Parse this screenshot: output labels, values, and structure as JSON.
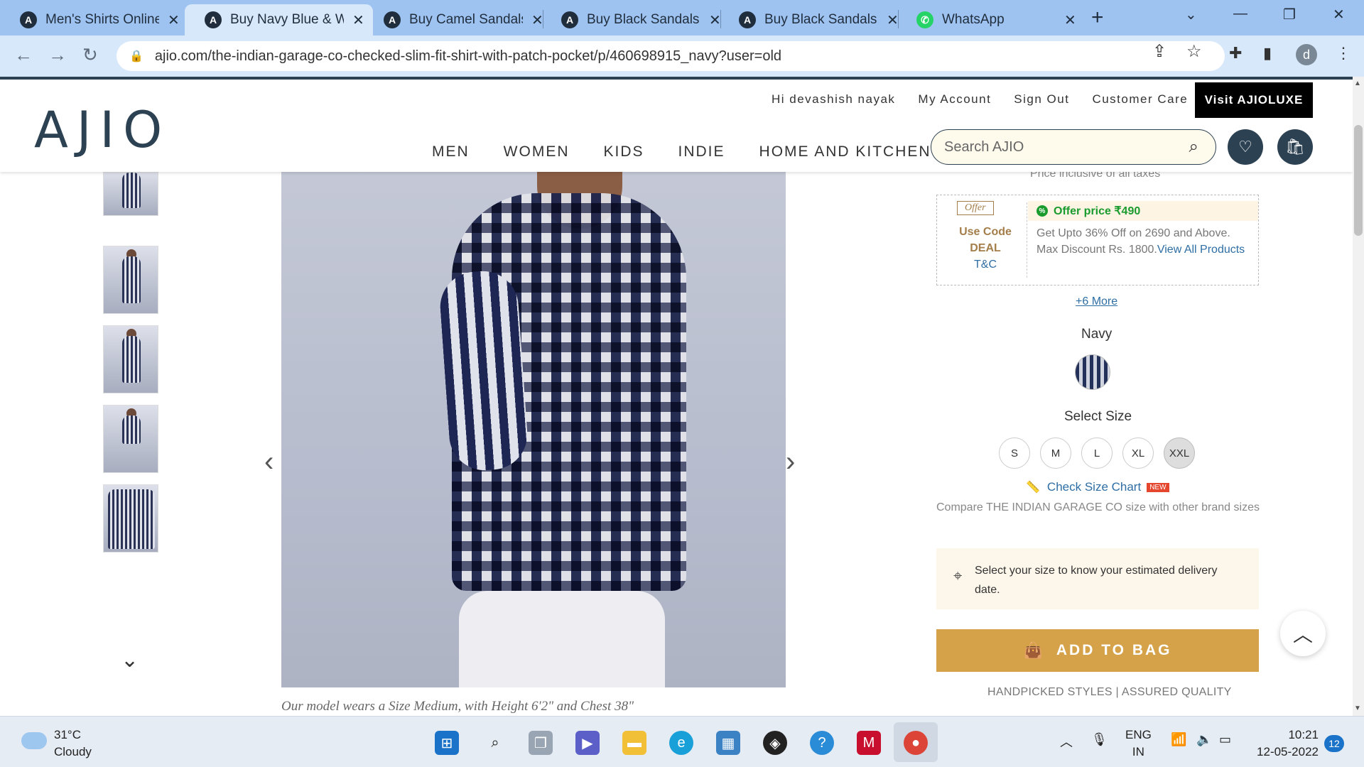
{
  "browser": {
    "tabs": [
      {
        "title": "Men's Shirts Online",
        "icon": "ajio-icon"
      },
      {
        "title": "Buy Navy Blue & White",
        "icon": "ajio-icon",
        "active": true
      },
      {
        "title": "Buy Camel Sandals",
        "icon": "ajio-icon"
      },
      {
        "title": "Buy Black Sandals f",
        "icon": "ajio-icon"
      },
      {
        "title": "Buy Black Sandals f",
        "icon": "ajio-icon"
      },
      {
        "title": "WhatsApp",
        "icon": "whatsapp-icon"
      }
    ],
    "url": "ajio.com/the-indian-garage-co-checked-slim-fit-shirt-with-patch-pocket/p/460698915_navy?user=old",
    "profile_initial": "d"
  },
  "header": {
    "logo": "AJIO",
    "greeting": "Hi devashish nayak",
    "links": [
      "My Account",
      "Sign Out",
      "Customer Care"
    ],
    "luxe": "Visit AJIOLUXE",
    "nav": [
      "MEN",
      "WOMEN",
      "KIDS",
      "INDIE",
      "HOME AND KITCHEN"
    ],
    "search_placeholder": "Search AJIO"
  },
  "product": {
    "caption": "Our model wears a Size Medium, with Height 6'2\" and Chest 38\"",
    "price_note": "Price inclusive of all taxes",
    "offer": {
      "tag": "Offer",
      "use_code": "Use Code",
      "code": "DEAL",
      "tc": "T&C",
      "offer_price": "Offer price ₹490",
      "desc": "Get Upto 36% Off on 2690 and Above. Max Discount Rs. 1800.",
      "link": "View All Products"
    },
    "more": "+6 More",
    "color": "Navy",
    "select_size": "Select Size",
    "sizes": [
      "S",
      "M",
      "L",
      "XL",
      "XXL"
    ],
    "selected_size": "XXL",
    "size_chart": "Check Size Chart",
    "new_badge": "NEW",
    "compare": "Compare THE INDIAN GARAGE CO size with other brand sizes",
    "delivery": "Select your size to know your estimated delivery date.",
    "add_to_bag": "ADD TO BAG",
    "handpicked": "HANDPICKED STYLES | ASSURED QUALITY"
  },
  "taskbar": {
    "temp": "31°C",
    "weather": "Cloudy",
    "lang1": "ENG",
    "lang2": "IN",
    "time": "10:21",
    "date": "12-05-2022",
    "notifications": "12"
  }
}
